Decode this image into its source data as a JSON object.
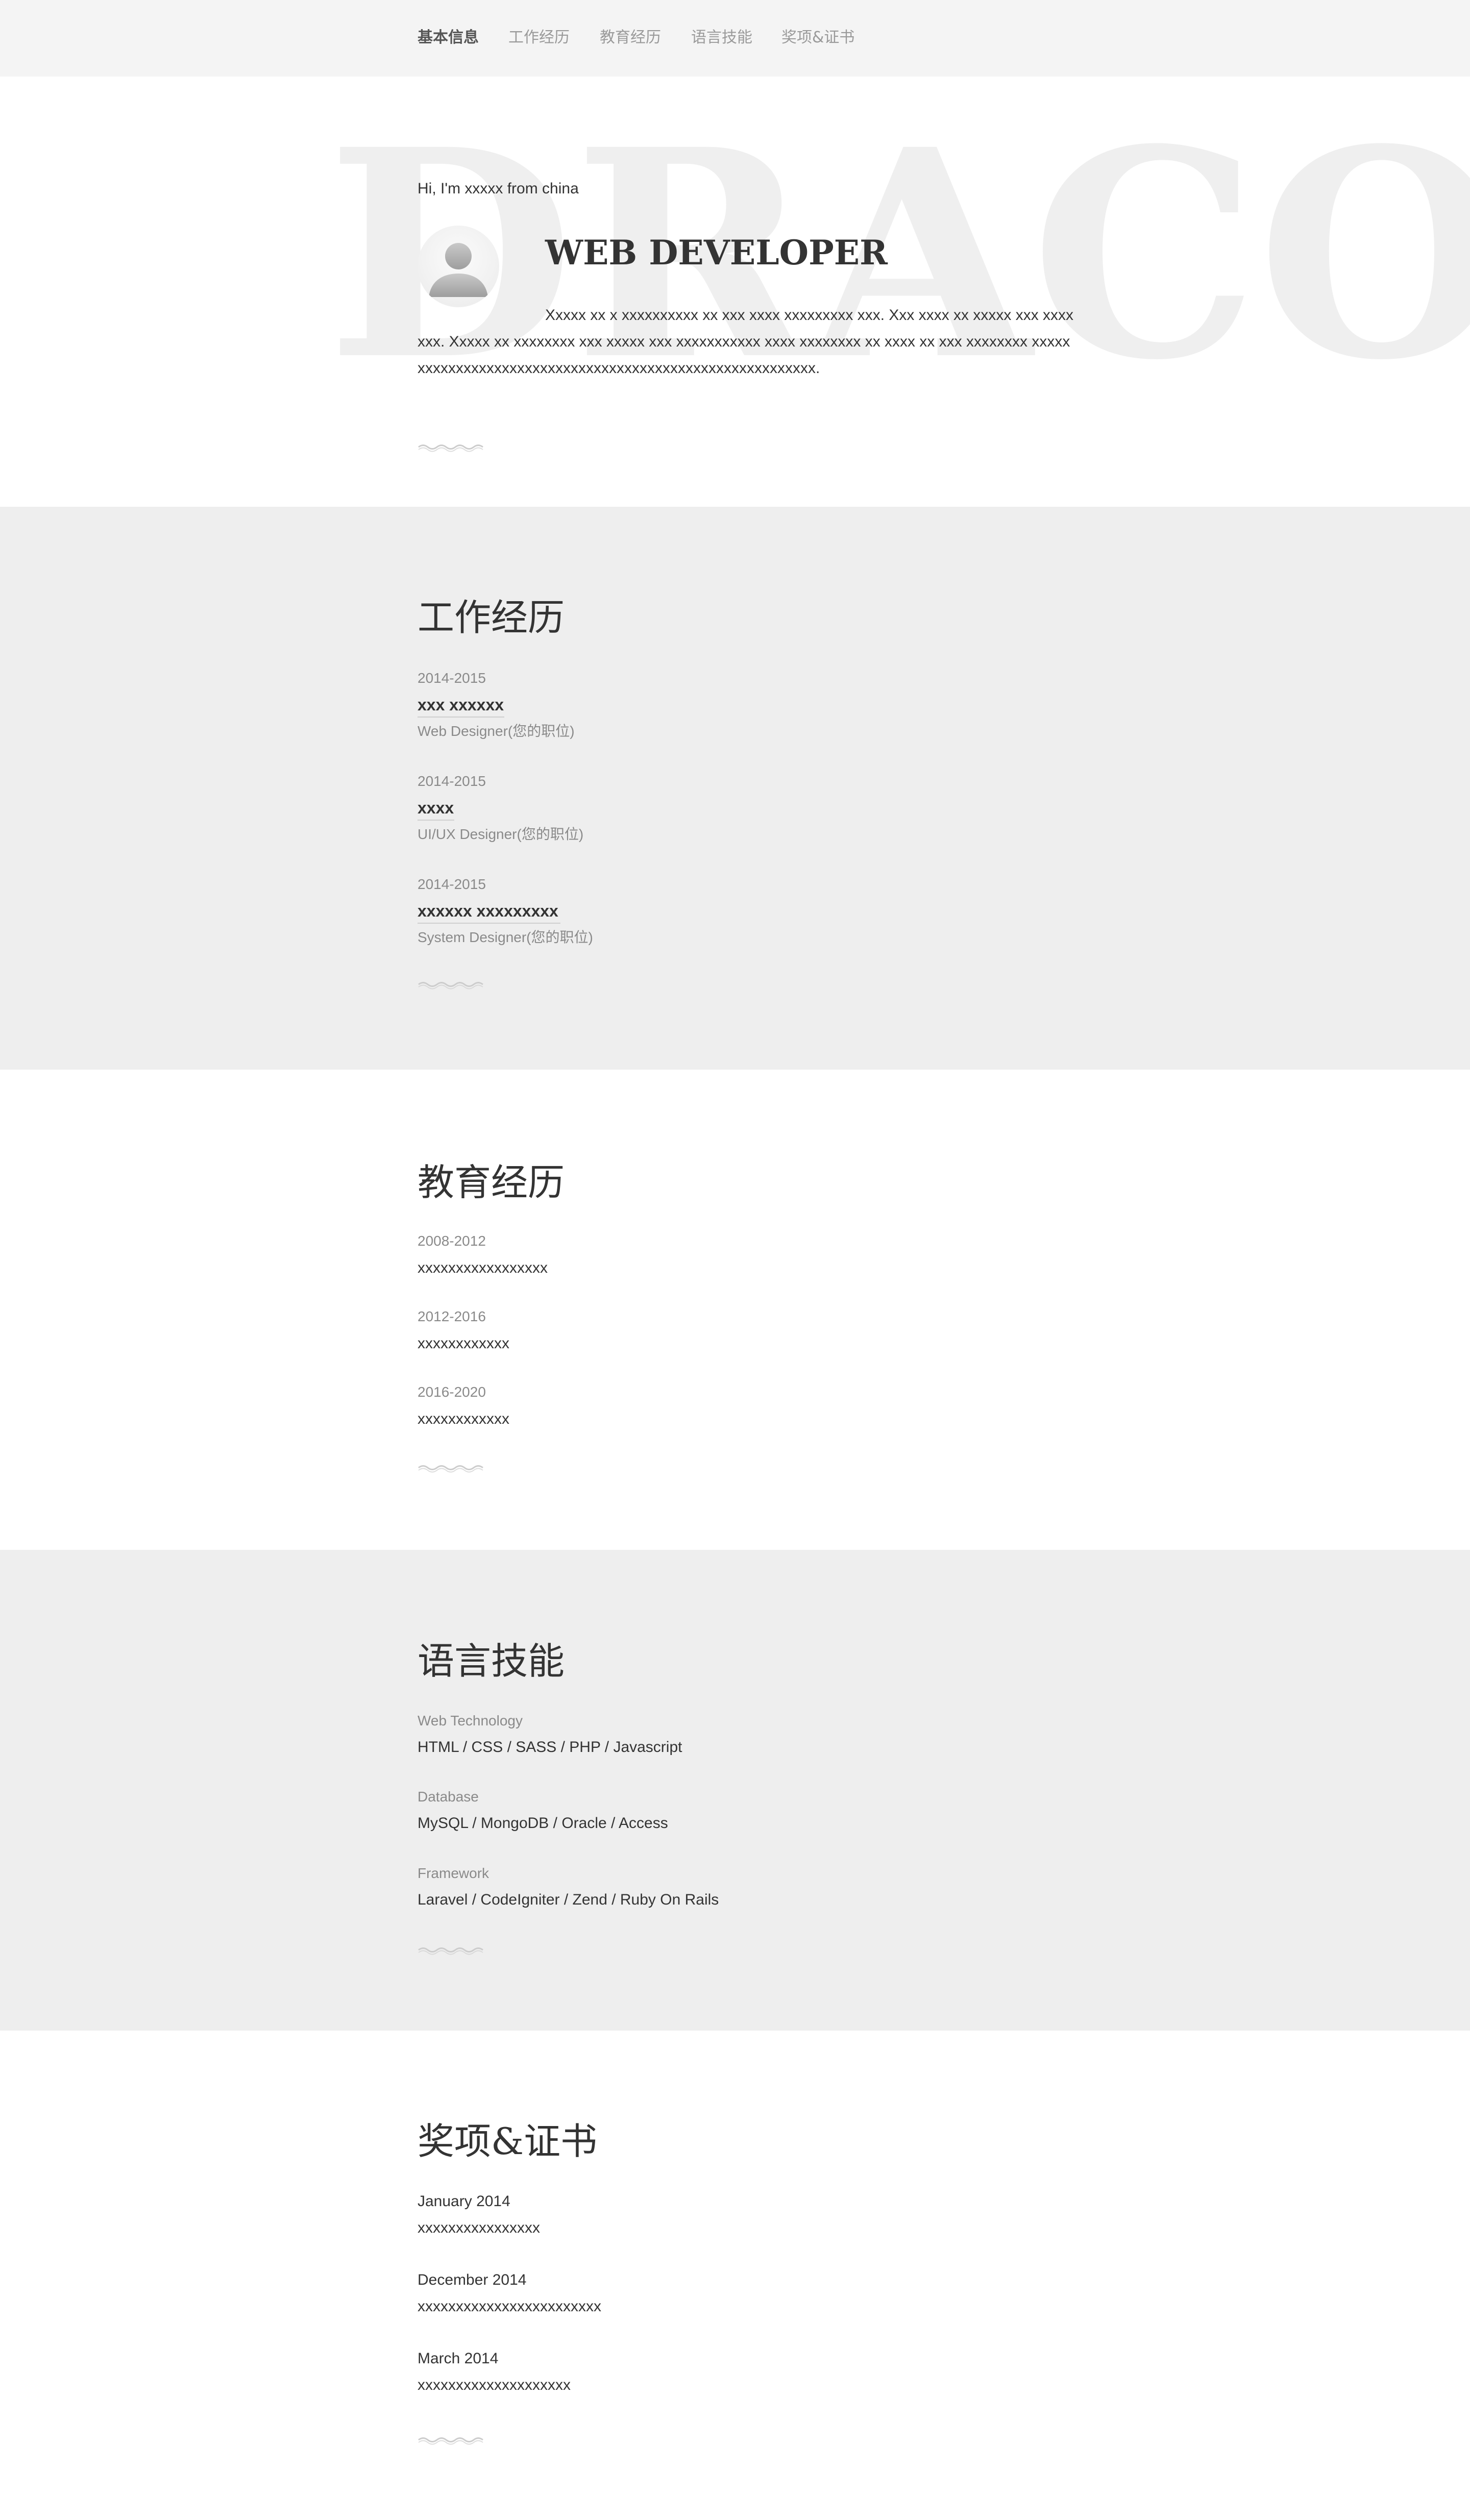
{
  "nav": {
    "items": [
      {
        "label": "基本信息",
        "active": true
      },
      {
        "label": "工作经历",
        "active": false
      },
      {
        "label": "教育经历",
        "active": false
      },
      {
        "label": "语言技能",
        "active": false
      },
      {
        "label": "奖项&证书",
        "active": false
      }
    ]
  },
  "hero": {
    "watermark": "DRACO",
    "greeting": "Hi, I'm xxxxx from china",
    "title": "WEB DEVELOPER",
    "intro": "Xxxxx xx x xxxxxxxxxx xx xxx xxxx xxxxxxxxx xxx. Xxx xxxx xx xxxxx xxx xxxxxxx. Xxxxx xx xxxxxxxx xxx xxxxx xxx xxxxxxxxxxx xxxx xxxxxxxx xx xxxx xx xxx xxxxxxxx xxxxxxxxxxxxxxxxxxxxxxxxxxxxxxxxxxxxxxxxxxxxxxxxxxxxxxxxx.",
    "avatar_icon": "user-silhouette-icon"
  },
  "work": {
    "title": "工作经历",
    "entries": [
      {
        "period": "2014-2015",
        "company": "xxx xxxxxx",
        "position": "Web Designer(您的职位)"
      },
      {
        "period": "2014-2015",
        "company": "xxxx",
        "position": "UI/UX Designer(您的职位)"
      },
      {
        "period": "2014-2015",
        "company": "xxxxxx xxxxxxxxx",
        "position": "System Designer(您的职位)"
      }
    ]
  },
  "education": {
    "title": "教育经历",
    "entries": [
      {
        "period": "2008-2012",
        "school": "xxxxxxxxxxxxxxxxx"
      },
      {
        "period": "2012-2016",
        "school": "xxxxxxxxxxxx"
      },
      {
        "period": "2016-2020",
        "school": "xxxxxxxxxxxx"
      }
    ]
  },
  "skills": {
    "title": "语言技能",
    "entries": [
      {
        "category": "Web Technology",
        "items": "HTML / CSS / SASS / PHP / Javascript"
      },
      {
        "category": "Database",
        "items": "MySQL / MongoDB / Oracle / Access"
      },
      {
        "category": "Framework",
        "items": "Laravel / CodeIgniter / Zend / Ruby On Rails"
      }
    ]
  },
  "awards": {
    "title": "奖项&证书",
    "entries": [
      {
        "date": "January 2014",
        "name": "xxxxxxxxxxxxxxxx"
      },
      {
        "date": "December 2014",
        "name": "xxxxxxxxxxxxxxxxxxxxxxxx"
      },
      {
        "date": "March 2014",
        "name": "xxxxxxxxxxxxxxxxxxxx"
      }
    ]
  },
  "colors": {
    "nav_bg": "#f4f4f4",
    "gray_section_bg": "#eeeeee",
    "text": "#333333",
    "muted": "#8a8a8a",
    "watermark": "#efefef"
  }
}
